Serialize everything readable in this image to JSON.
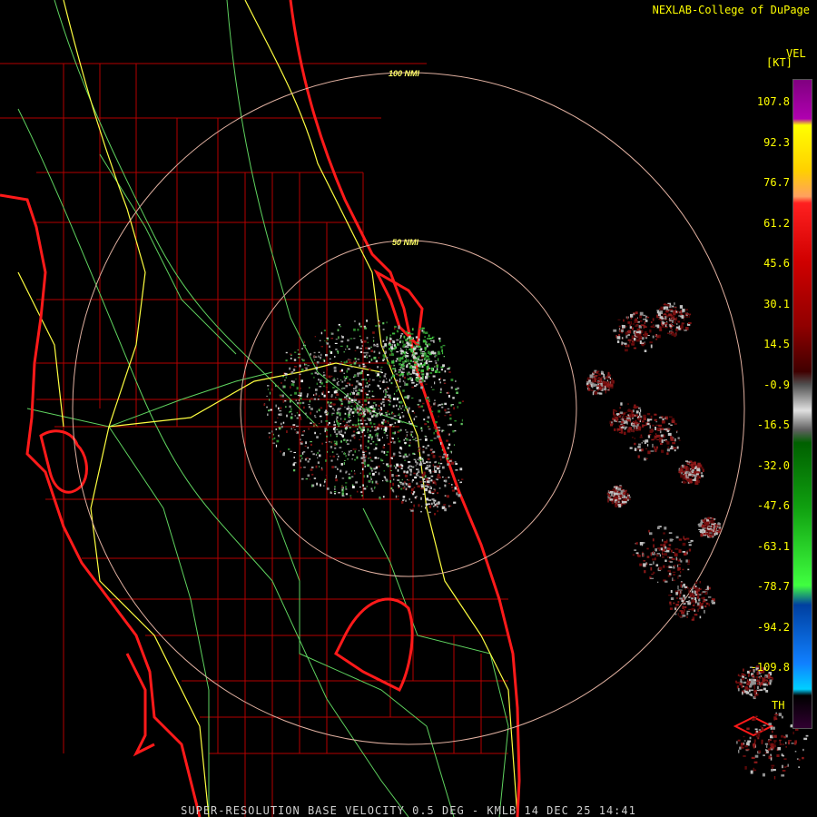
{
  "header": {
    "credit": "NEXLAB-College of DuPage"
  },
  "map": {
    "range_rings": [
      {
        "label": "50 NMI"
      },
      {
        "label": "100 NMI"
      }
    ],
    "colors": {
      "coastline": "#ff1a1a",
      "county_lines": "#b40000",
      "roads_green": "#5fd35f",
      "roads_yellow": "#ffff40",
      "rings": "#e0b0a0",
      "background": "#000000"
    }
  },
  "legend": {
    "product": "VEL",
    "units": "[KT]",
    "ticks": [
      "107.8",
      "92.3",
      "76.7",
      "61.2",
      "45.6",
      "30.1",
      "14.5",
      "-0.9",
      "-16.5",
      "-32.0",
      "-47.6",
      "-63.1",
      "-78.7",
      "-94.2",
      "-109.8"
    ],
    "threshold": "TH"
  },
  "caption": "SUPER-RESOLUTION BASE VELOCITY 0.5 DEG - KMLB 14 DEC 25 14:41"
}
